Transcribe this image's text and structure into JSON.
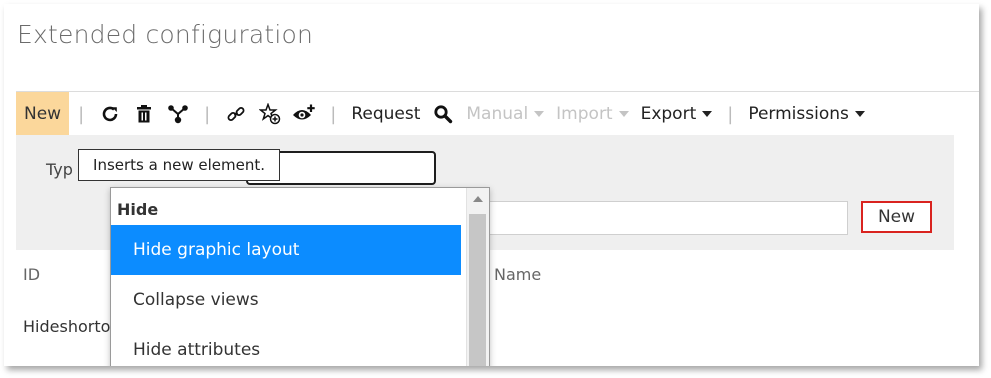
{
  "page": {
    "title": "Extended configuration"
  },
  "toolbar": {
    "new_label": "New",
    "request_label": "Request",
    "manual_label": "Manual",
    "import_label": "Import",
    "export_label": "Export",
    "permissions_label": "Permissions",
    "icons": [
      "refresh-icon",
      "delete-icon",
      "hierarchy-icon",
      "link-icon",
      "star-add-icon",
      "view-add-icon",
      "search-icon"
    ]
  },
  "form": {
    "type_label": "Typ",
    "new_button_label": "New",
    "tooltip": "Inserts a new element."
  },
  "dropdown": {
    "group_label": "Hide",
    "items": [
      {
        "label": "Hide graphic layout",
        "selected": true
      },
      {
        "label": "Collapse views",
        "selected": false
      },
      {
        "label": "Hide attributes",
        "selected": false
      }
    ]
  },
  "table": {
    "columns": [
      "ID",
      "Name"
    ],
    "rows": [
      {
        "id": "Hideshorto"
      }
    ]
  },
  "colors": {
    "highlight": "#0c8cff",
    "new_tab": "#fbd79b",
    "callout_border": "#d9231f",
    "panel_bg": "#efefef"
  }
}
